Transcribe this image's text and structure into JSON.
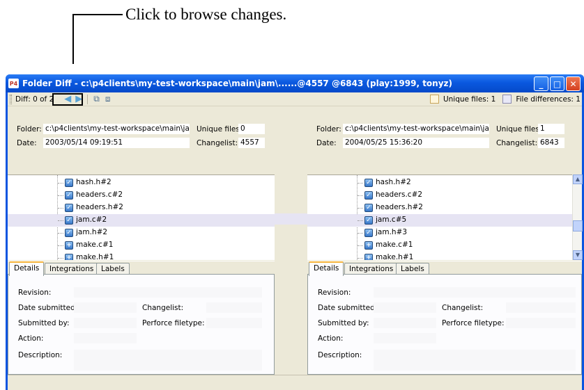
{
  "annotation": {
    "text": "Click to browse changes."
  },
  "window": {
    "title": "Folder Diff - c:\\p4clients\\my-test-workspace\\main\\jam\\......@4557 @6843    (play:1999, tonyz)",
    "app_icon": "P4"
  },
  "toolbar": {
    "diff_label": "Diff: 0 of 2",
    "unique_files_label": "Unique files: 1",
    "file_differences_label": "File differences: 1"
  },
  "labels": {
    "folder": "Folder:",
    "date": "Date:",
    "unique_files": "Unique files:",
    "changelist": "Changelist:"
  },
  "left": {
    "folder": "c:\\p4clients\\my-test-workspace\\main\\jam\\...",
    "date": "2003/05/14 09:19:51",
    "unique_files": "0",
    "changelist": "4557",
    "files": [
      "hash.h#2",
      "headers.c#2",
      "headers.h#2",
      "jam.c#2",
      "jam.h#2",
      "make.c#1",
      "make.h#1"
    ]
  },
  "right": {
    "folder": "c:\\p4clients\\my-test-workspace\\main\\jam\\...",
    "date": "2004/05/25 15:36:20",
    "unique_files": "1",
    "changelist": "6843",
    "files": [
      "hash.h#2",
      "headers.c#2",
      "headers.h#2",
      "jam.c#5",
      "jam.h#3",
      "make.c#1",
      "make.h#1"
    ]
  },
  "tabs": [
    "Details",
    "Integrations",
    "Labels"
  ],
  "details": {
    "revision": "Revision:",
    "date_submitted": "Date submitted:",
    "changelist": "Changelist:",
    "submitted_by": "Submitted by:",
    "filetype": "Perforce filetype:",
    "action": "Action:",
    "description": "Description:"
  }
}
